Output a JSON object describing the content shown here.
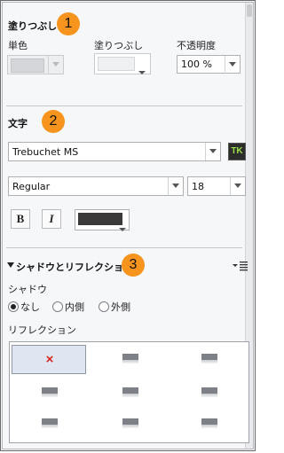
{
  "fill_section": {
    "heading": "塗りつぶし",
    "badge": "1",
    "labels": {
      "single_color": "単色",
      "fill": "塗りつぶし",
      "opacity": "不透明度"
    },
    "opacity_value": "100 %"
  },
  "text_section": {
    "heading": "文字",
    "badge": "2",
    "font_family": "Trebuchet MS",
    "tk_label": "TK",
    "font_style": "Regular",
    "font_size": "18",
    "bold_label": "B",
    "italic_label": "I",
    "text_color": "#3a3a3a"
  },
  "shadow_section": {
    "heading": "シャドウとリフレクション",
    "badge": "3",
    "shadow_label": "シャドウ",
    "shadow_options": [
      "なし",
      "内側",
      "外側"
    ],
    "shadow_selected": "なし",
    "reflection_label": "リフレクション",
    "reflection_none_mark": "×"
  },
  "colors": {
    "badge": "#f7941d",
    "selected_cell": "#dfe6f1",
    "tk_text": "#9be04a"
  }
}
